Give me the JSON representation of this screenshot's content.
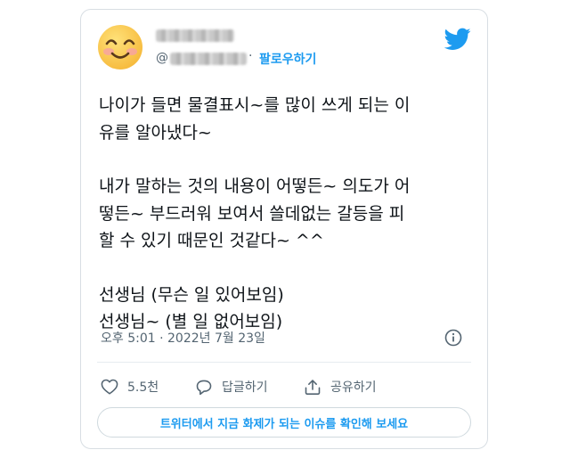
{
  "header": {
    "handle_prefix": "@",
    "separator": "·",
    "follow_label": "팔로우하기"
  },
  "tweet": {
    "lines": [
      "나이가 들면 물결표시~를 많이 쓰게 되는 이",
      "유를 알아냈다~",
      "",
      "내가 말하는 것의 내용이 어떻든~ 의도가 어",
      "떻든~ 부드러워 보여서 쓸데없는 갈등을 피",
      "할 수 있기 때문인 것같다~ ^^",
      "",
      "선생님 (무슨 일 있어보임)",
      "선생님~ (별 일 없어보임)"
    ],
    "timestamp": "오후 5:01 · 2022년 7월 23일"
  },
  "actions": {
    "like_count": "5.5천",
    "reply_label": "답글하기",
    "share_label": "공유하기"
  },
  "cta": {
    "label": "트위터에서 지금 화제가 되는 이슈를 확인해 보세요"
  },
  "icons": {
    "avatar": "smiling-face-emoji",
    "brand": "twitter-bird-icon",
    "info": "info-icon",
    "like": "heart-icon",
    "reply": "reply-bubble-icon",
    "share": "share-arrow-icon"
  },
  "colors": {
    "accent": "#1d9bf0",
    "text": "#0f1419",
    "muted": "#536471",
    "border": "#d8dee3"
  }
}
